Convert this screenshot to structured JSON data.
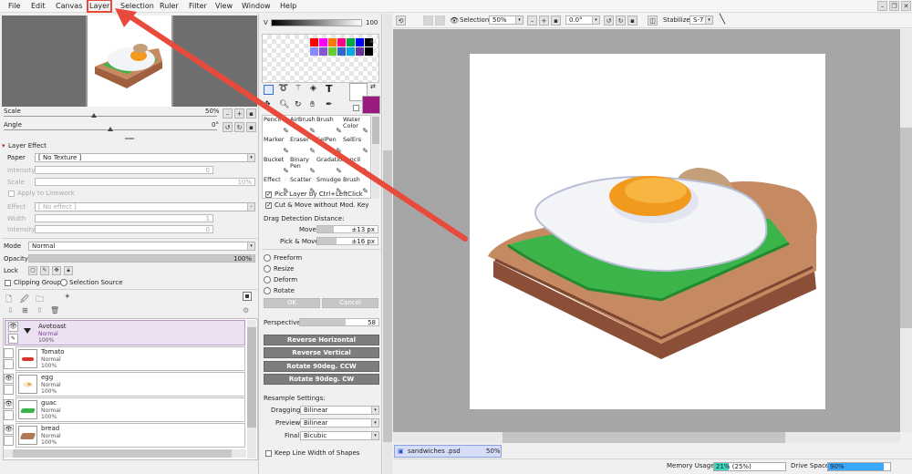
{
  "menu": [
    "File",
    "Edit",
    "Canvas",
    "Layer",
    "Selection",
    "Ruler",
    "Filter",
    "View",
    "Window",
    "Help"
  ],
  "navigator": {
    "scale_label": "Scale",
    "scale_value": "50%",
    "angle_label": "Angle",
    "angle_value": "0°"
  },
  "layer_effect": {
    "title": "Layer Effect",
    "paper_label": "Paper",
    "paper_value": "[ No Texture ]",
    "intensity_label": "Intensity",
    "intensity_value": "0",
    "scale_label": "Scale",
    "scale_value": "10%",
    "apply_label": "Apply to Linework",
    "effect_label": "Effect",
    "effect_value": "[ No effect ]",
    "width_label": "Width",
    "width_value": "1",
    "effect_intensity_label": "Intensity",
    "effect_intensity_value": "0"
  },
  "layer_props": {
    "mode_label": "Mode",
    "mode_value": "Normal",
    "opacity_label": "Opacity",
    "opacity_value": "100%",
    "lock_label": "Lock",
    "clipping_label": "Clipping Group",
    "selection_source_label": "Selection Source"
  },
  "layers": [
    {
      "name": "Avotoast",
      "mode": "Normal",
      "opacity": "100%",
      "type": "folder"
    },
    {
      "name": "Tomato",
      "mode": "Normal",
      "opacity": "100%",
      "color": "#d9342b"
    },
    {
      "name": "egg",
      "mode": "Normal",
      "opacity": "100%",
      "color": "#f4a62a"
    },
    {
      "name": "guac",
      "mode": "Normal",
      "opacity": "100%",
      "color": "#3bb54a"
    },
    {
      "name": "bread",
      "mode": "Normal",
      "opacity": "100%",
      "color": "#b07a55"
    }
  ],
  "color": {
    "v_label": "V",
    "v_value": "100",
    "primary": "#ffffff",
    "secondary": "#9b1a7d"
  },
  "swatches": [
    "#ff0000",
    "#ff00ff",
    "#ff7700",
    "#ff0088",
    "#00aa44",
    "#0000ff",
    "#000000",
    "#8888ff",
    "#8855cc",
    "#66cc33",
    "#3366cc",
    "#00aadd",
    "#663399",
    "#000000"
  ],
  "tools": [
    [
      {
        "label": "Pencil"
      },
      {
        "label": "AirBrush"
      },
      {
        "label": "Brush"
      },
      {
        "label": "Water Color"
      }
    ],
    [
      {
        "label": "Marker"
      },
      {
        "label": "Eraser"
      },
      {
        "label": "SelPen"
      },
      {
        "label": "SelErs"
      }
    ],
    [
      {
        "label": "Bucket"
      },
      {
        "label": "Binary Pen"
      },
      {
        "label": "Gradation"
      },
      {
        "label": "Pencil"
      }
    ],
    [
      {
        "label": "Effect"
      },
      {
        "label": "Scatter"
      },
      {
        "label": "Smudge"
      },
      {
        "label": "Brush"
      }
    ]
  ],
  "transform": {
    "pick_layer": "Pick Layer by Ctrl+LeftClick",
    "cut_move": "Cut & Move without Mod. Key",
    "drag_label": "Drag Detection Distance:",
    "move_label": "Move",
    "move_value": "±13 px",
    "pickmove_label": "Pick & Move",
    "pickmove_value": "±16 px",
    "modes": [
      "Freeform",
      "Resize",
      "Deform",
      "Rotate"
    ],
    "ok": "OK",
    "cancel": "Cancel",
    "perspective_label": "Perspective",
    "perspective_value": "58",
    "reverse_h": "Reverse Horizontal",
    "reverse_v": "Reverse Vertical",
    "rot_ccw": "Rotate 90deg. CCW",
    "rot_cw": "Rotate 90deg. CW",
    "resample_label": "Resample Settings:",
    "dragging_label": "Dragging",
    "dragging_value": "Bilinear",
    "preview_label": "Preview",
    "preview_value": "Bilinear",
    "final_label": "Final",
    "final_value": "Bicubic",
    "keep_line": "Keep Line Width of Shapes"
  },
  "canvas_toolbar": {
    "selection_label": "Selection",
    "zoom_value": "50%",
    "angle_value": "0.0°",
    "stabilizer_label": "Stabilizer",
    "stabilizer_value": "S-7"
  },
  "document_tab": {
    "name": "sandwiches .psd",
    "zoom": "50%"
  },
  "status": {
    "memory_label": "Memory Usage",
    "memory_value": "21% (25%)",
    "memory_fraction": 0.21,
    "drive_label": "Drive Space",
    "drive_value": "90%",
    "drive_fraction": 0.9
  },
  "annotation_color": "#e84a3c"
}
